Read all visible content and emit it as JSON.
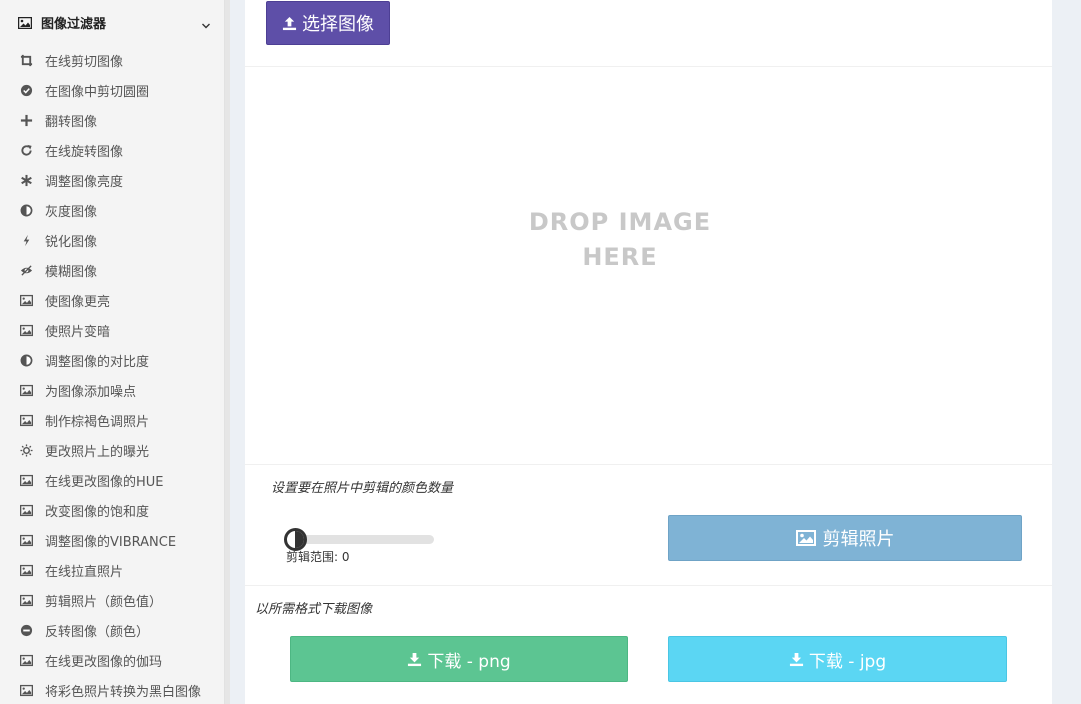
{
  "sidebar": {
    "header": {
      "title": "图像过滤器",
      "icon": "image-icon",
      "chevron": "chevron-down-icon"
    },
    "items": [
      {
        "label": "在线剪切图像",
        "icon": "crop-icon"
      },
      {
        "label": "在图像中剪切圆圈",
        "icon": "check-circle-icon"
      },
      {
        "label": "翻转图像",
        "icon": "plus-icon"
      },
      {
        "label": "在线旋转图像",
        "icon": "rotate-icon"
      },
      {
        "label": "调整图像亮度",
        "icon": "asterisk-icon"
      },
      {
        "label": "灰度图像",
        "icon": "half-circle-icon"
      },
      {
        "label": "锐化图像",
        "icon": "bolt-icon"
      },
      {
        "label": "模糊图像",
        "icon": "eye-slash-icon"
      },
      {
        "label": "使图像更亮",
        "icon": "image-icon"
      },
      {
        "label": "使照片变暗",
        "icon": "image-icon"
      },
      {
        "label": "调整图像的对比度",
        "icon": "half-circle-icon"
      },
      {
        "label": "为图像添加噪点",
        "icon": "image-icon"
      },
      {
        "label": "制作棕褐色调照片",
        "icon": "image-icon"
      },
      {
        "label": "更改照片上的曝光",
        "icon": "sun-icon"
      },
      {
        "label": "在线更改图像的HUE",
        "icon": "image-icon"
      },
      {
        "label": "改变图像的饱和度",
        "icon": "image-icon"
      },
      {
        "label": "调整图像的VIBRANCE",
        "icon": "image-icon"
      },
      {
        "label": "在线拉直照片",
        "icon": "image-icon"
      },
      {
        "label": "剪辑照片（颜色值）",
        "icon": "image-icon"
      },
      {
        "label": "反转图像（颜色）",
        "icon": "minus-circle-icon"
      },
      {
        "label": "在线更改图像的伽玛",
        "icon": "image-icon"
      },
      {
        "label": "将彩色照片转换为黑白图像",
        "icon": "image-icon"
      }
    ]
  },
  "main": {
    "select_button": "选择图像",
    "drop_line1": "DROP IMAGE",
    "drop_line2": "HERE",
    "setting_label": "设置要在照片中剪辑的颜色数量",
    "range_label": "剪辑范围: 0",
    "slider_value": 0,
    "crop_button": "剪辑照片",
    "download_label": "以所需格式下载图像",
    "download_png": "下载 - png",
    "download_jpg": "下载 - jpg"
  },
  "colors": {
    "select_button": "#5e4fa8",
    "crop_button": "#7fb3d5",
    "download_png": "#5cc592",
    "download_jpg": "#5bd6f3"
  }
}
